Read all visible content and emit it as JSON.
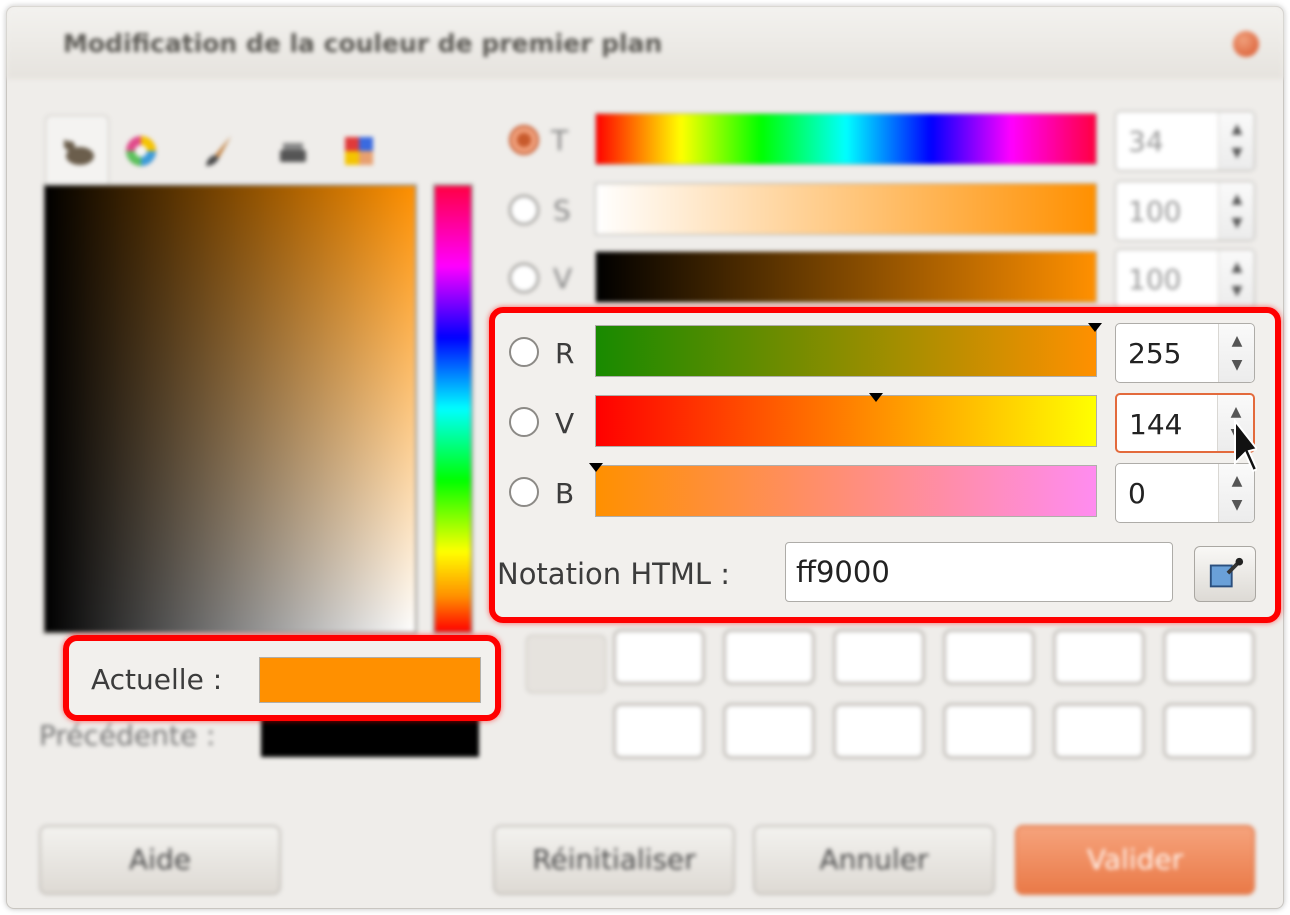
{
  "window": {
    "title": "Modification de la couleur de premier plan"
  },
  "tabs": [
    {
      "icon": "gimp-icon",
      "active": true
    },
    {
      "icon": "color-wheel-icon",
      "active": false
    },
    {
      "icon": "brush-icon",
      "active": false
    },
    {
      "icon": "printer-icon",
      "active": false
    },
    {
      "icon": "palette-icon",
      "active": false
    }
  ],
  "hsv": [
    {
      "label": "T",
      "value": "34",
      "checked": true
    },
    {
      "label": "S",
      "value": "100",
      "checked": false
    },
    {
      "label": "V",
      "value": "100",
      "checked": false
    }
  ],
  "rgb": [
    {
      "label": "R",
      "value": "255",
      "checked": false
    },
    {
      "label": "V",
      "value": "144",
      "checked": false
    },
    {
      "label": "B",
      "value": "0",
      "checked": false
    }
  ],
  "html_notation": {
    "label": "Notation HTML :",
    "value": "ff9000"
  },
  "current": {
    "label": "Actuelle :",
    "color": "#ff9000"
  },
  "previous": {
    "label": "Précédente :",
    "color": "#000000"
  },
  "buttons": {
    "help": "Aide",
    "reset": "Réinitialiser",
    "cancel": "Annuler",
    "ok": "Valider"
  },
  "colors": {
    "highlight": "#ff0000",
    "accent": "#ea7a48"
  }
}
